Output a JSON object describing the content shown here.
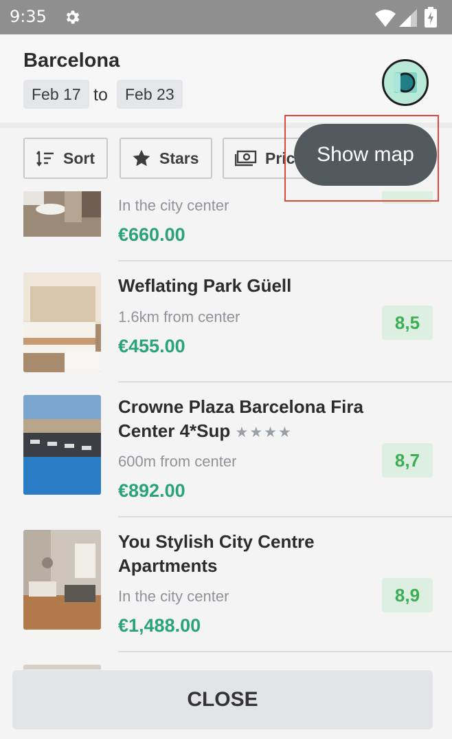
{
  "status_bar": {
    "time": "9:35"
  },
  "header": {
    "city": "Barcelona",
    "check_in": "Feb 17",
    "to": "to",
    "check_out": "Feb 23"
  },
  "filters": {
    "sort": "Sort",
    "stars": "Stars",
    "price": "Price"
  },
  "show_map": "Show map",
  "hotels": [
    {
      "name": "",
      "distance": "In the city center",
      "price": "€660.00",
      "score": ""
    },
    {
      "name": "Weflating Park Güell",
      "distance": "1.6km from center",
      "price": "€455.00",
      "score": "8,5"
    },
    {
      "name": "Crowne Plaza Barcelona Fira Center 4*Sup",
      "stars": "★★★★",
      "distance": "600m from center",
      "price": "€892.00",
      "score": "8,7"
    },
    {
      "name": "You Stylish City Centre Apartments",
      "distance": "In the city center",
      "price": "€1,488.00",
      "score": "8,9"
    }
  ],
  "close_label": "CLOSE",
  "colors": {
    "price": "#2aa37a",
    "score_text": "#3cae54",
    "score_bg": "#dcefe1",
    "map_button": "#535a5e"
  }
}
